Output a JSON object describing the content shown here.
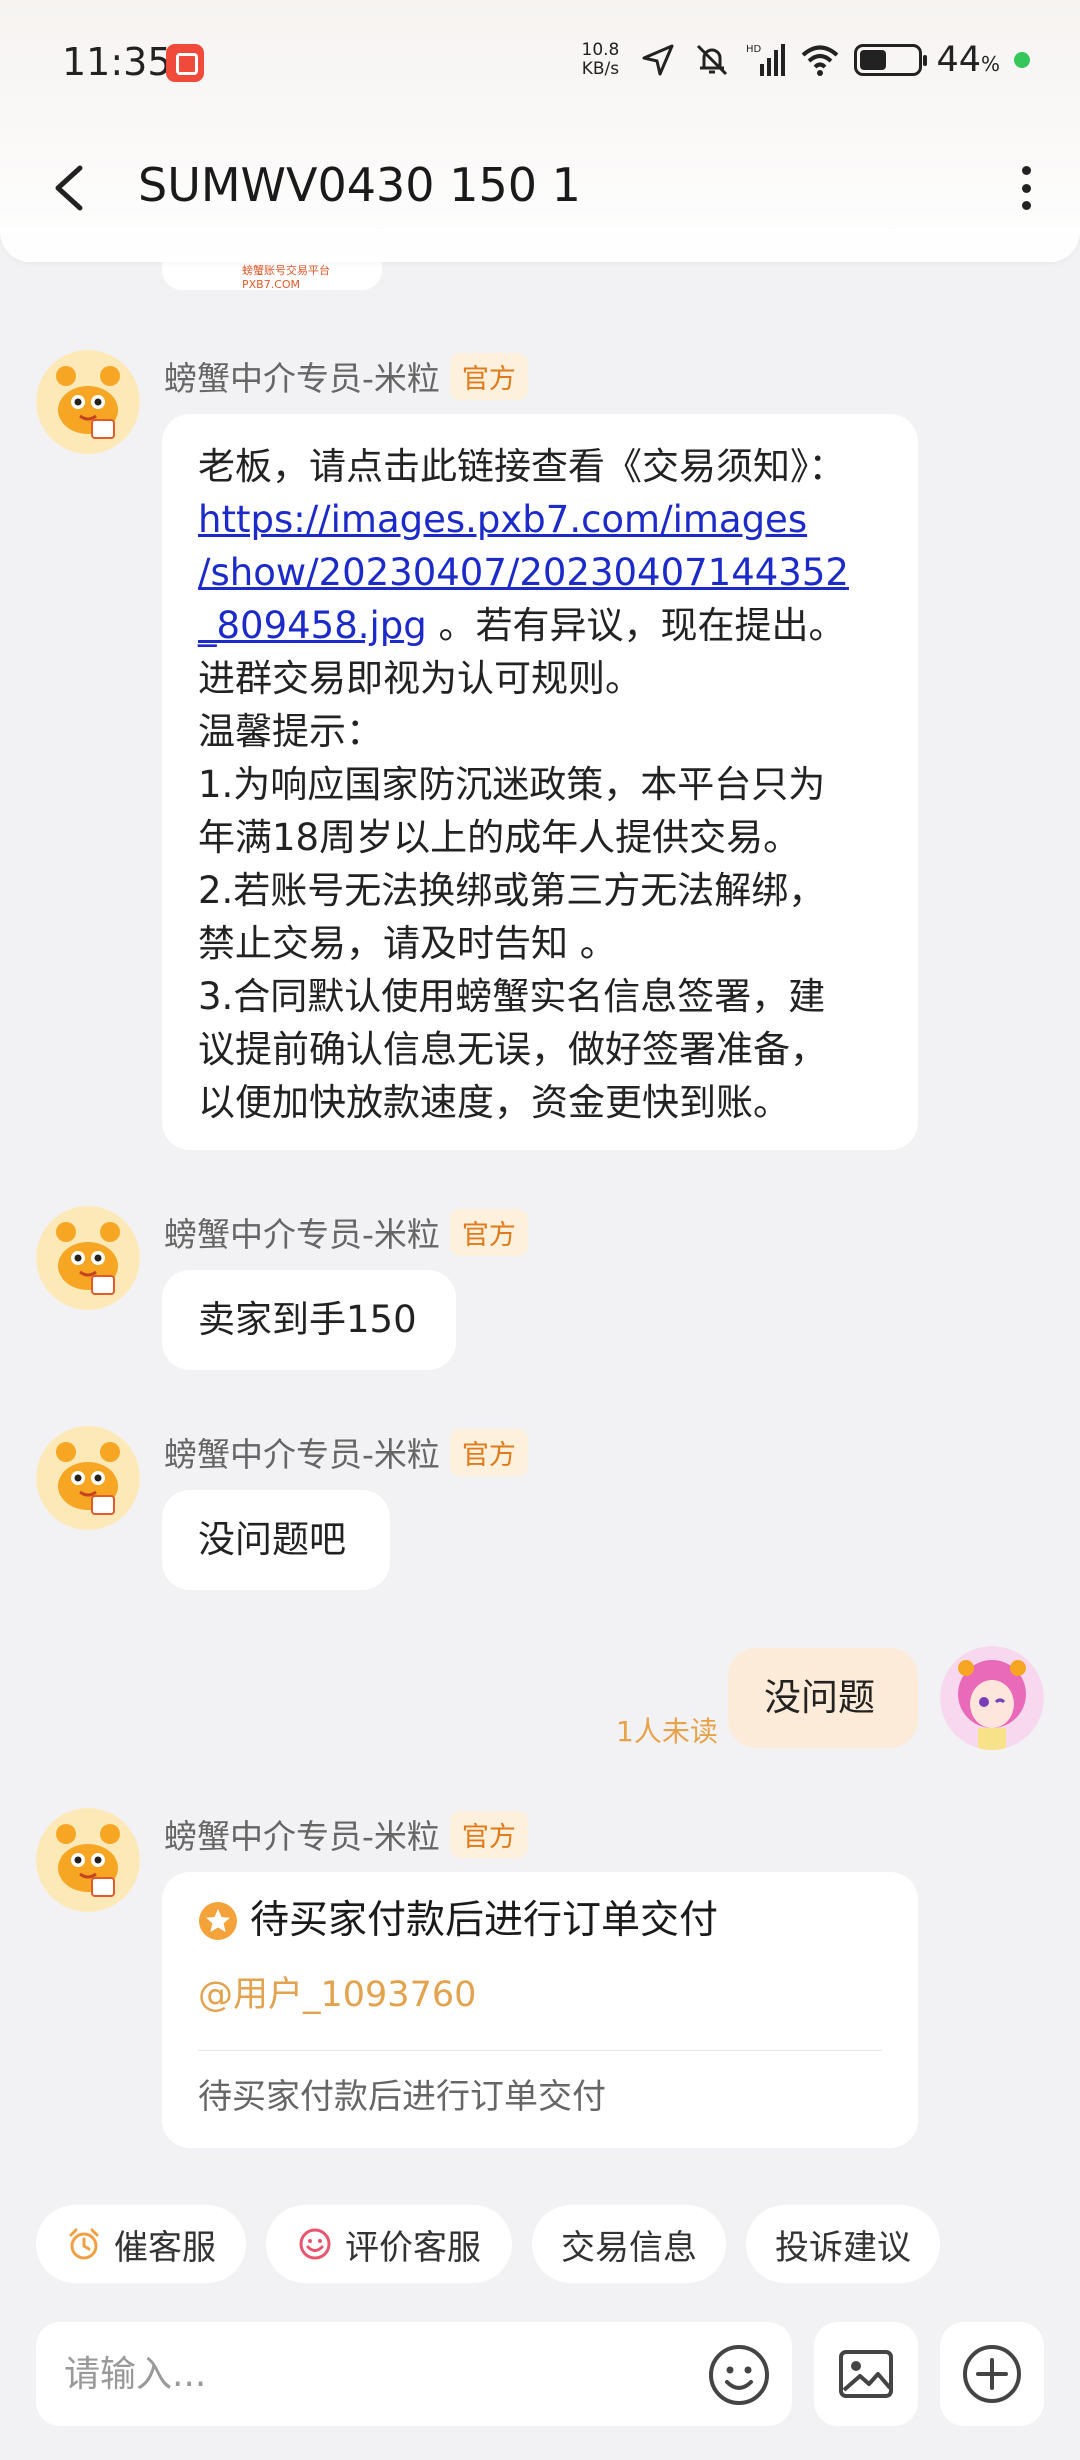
{
  "status_bar": {
    "time": "11:35",
    "net_speed_value": "10.8",
    "net_speed_unit": "KB/s",
    "battery_percent": "44",
    "battery_unit": "%"
  },
  "header": {
    "title": "SUMWV0430 150 1"
  },
  "prev_card_text": "螃蟹账号交易平台 PXB7.COM",
  "official_badge": "官方",
  "messages": [
    {
      "sender": "螃蟹中介专员-米粒",
      "text_intro": "老板，请点击此链接查看《交易须知》：",
      "link": "https://images.pxb7.com/images/show/20230407/20230407144352_809458.jpg",
      "link_line1": "https://images.pxb7.com/images",
      "link_line2": "/show/20230407/20230407144352",
      "link_line3": "_809458.jpg",
      "link_after": " 。若有异议，现在提出。",
      "line_join": "进群交易即视为认可规则。",
      "line_tip": "温馨提示：",
      "line_1a": "1.为响应国家防沉迷政策，本平台只为",
      "line_1b": "年满18周岁以上的成年人提供交易。",
      "line_2a": "2.若账号无法换绑或第三方无法解绑，",
      "line_2b": "禁止交易，请及时告知 。",
      "line_3a": "3.合同默认使用螃蟹实名信息签署，建",
      "line_3b": "议提前确认信息无误，做好签署准备，",
      "line_3c": "以便加快放款速度，资金更快到账。"
    },
    {
      "sender": "螃蟹中介专员-米粒",
      "text": "卖家到手150"
    },
    {
      "sender": "螃蟹中介专员-米粒",
      "text": "没问题吧"
    },
    {
      "sender": "me",
      "text": "没问题",
      "status": "1人未读"
    },
    {
      "sender": "螃蟹中介专员-米粒",
      "card_title": "待买家付款后进行订单交付",
      "card_mention": "@用户_1093760",
      "card_desc": "待买家付款后进行订单交付"
    }
  ],
  "quick_actions": [
    {
      "label": "催客服",
      "icon": "alarm-clock-icon"
    },
    {
      "label": "评价客服",
      "icon": "smiley-icon"
    },
    {
      "label": "交易信息"
    },
    {
      "label": "投诉建议"
    }
  ],
  "input": {
    "placeholder": "请输入..."
  },
  "colors": {
    "accent_orange": "#e6a34a",
    "link_blue": "#1b2ac9",
    "my_bubble": "#fdebd9"
  }
}
